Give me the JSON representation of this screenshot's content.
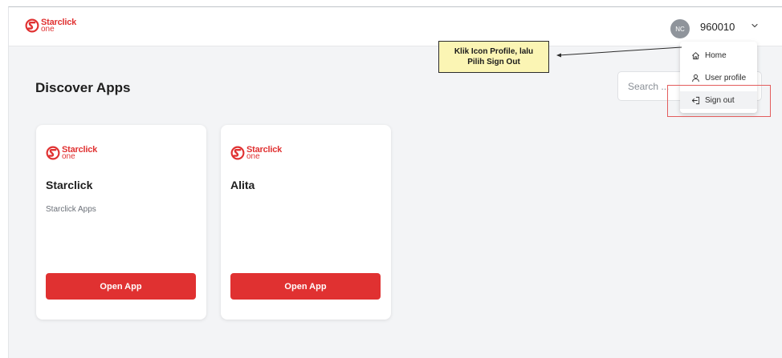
{
  "brand": {
    "line1": "Starclick",
    "line2": "one"
  },
  "header": {
    "avatar_initials": "NC",
    "username": "960010"
  },
  "main": {
    "title": "Discover Apps",
    "search_placeholder": "Search ..."
  },
  "apps": [
    {
      "name": "Starclick",
      "description": "Starclick Apps",
      "button": "Open App"
    },
    {
      "name": "Alita",
      "description": "",
      "button": "Open App"
    }
  ],
  "profile_menu": {
    "home": "Home",
    "user_profile": "User profile",
    "sign_out": "Sign out"
  },
  "annotation": {
    "line1": "Klik Icon Profile, lalu",
    "line2": "Pilih Sign Out"
  },
  "colors": {
    "brand_red": "#e03131",
    "callout_bg": "#fbf5b4",
    "highlight": "#e35d5d"
  }
}
